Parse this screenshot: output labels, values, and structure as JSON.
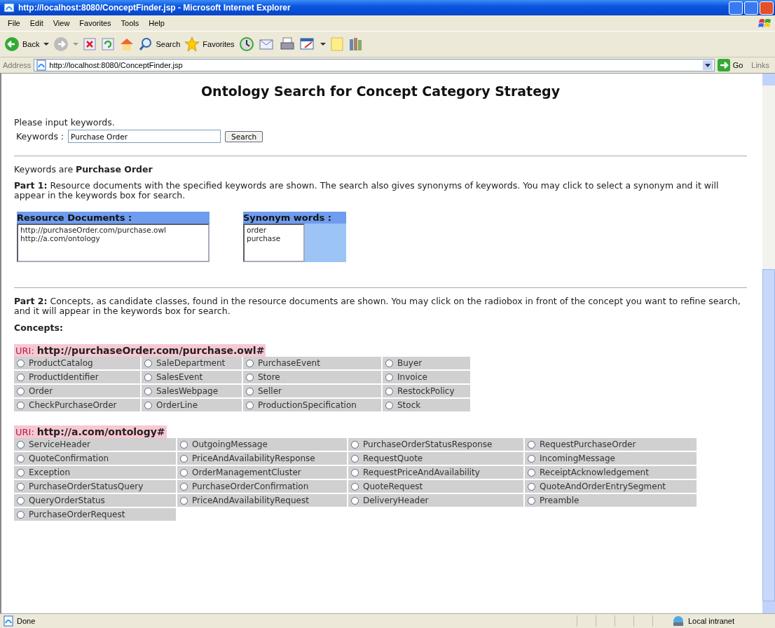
{
  "window": {
    "title": "http://localhost:8080/ConceptFinder.jsp - Microsoft Internet Explorer"
  },
  "menu_bar": [
    "File",
    "Edit",
    "View",
    "Favorites",
    "Tools",
    "Help"
  ],
  "toolbar": {
    "back": "Back",
    "search": "Search",
    "favorites": "Favorites"
  },
  "address_bar": {
    "label": "Address",
    "value": "http://localhost:8080/ConceptFinder.jsp",
    "go": "Go",
    "links": "Links"
  },
  "page": {
    "heading": "Ontology Search for Concept Category Strategy",
    "prompt": "Please input keywords.",
    "keyword_label": "Keywords :",
    "keyword_value": "Purchase Order",
    "search_button": "Search",
    "summary": "Keywords are **Purchase Order**",
    "part1": "**Part 1:** Resource documents with the specified keywords are shown. The search also gives synonyms of keywords. You may click to select a synonym and it will appear in the keywords box for search.",
    "resource_documents": {
      "header": "Resource Documents :",
      "items": [
        "http://purchaseOrder.com/purchase.owl",
        "http://a.com/ontology"
      ]
    },
    "synonyms": {
      "header": "Synonym words :",
      "items": [
        "order",
        "purchase"
      ]
    },
    "part2": "**Part 2:** Concepts, as candidate classes, found in the resource documents are shown. You may click on the radiobox in front of the concept you want to refine search, and it will appear in the keywords box for search.",
    "concepts_label": "Concepts:",
    "ontologies": [
      {
        "uri_label": "URI:",
        "uri": "http://purchaseOrder.com/purchase.owl#",
        "concepts": [
          {
            "label": "ProductCatalog",
            "selected": false
          },
          {
            "label": "SaleDepartment",
            "selected": false
          },
          {
            "label": "PurchaseEvent",
            "selected": false
          },
          {
            "label": "Buyer",
            "selected": false
          },
          {
            "label": "ProductIdentifier",
            "selected": false
          },
          {
            "label": "SalesEvent",
            "selected": false
          },
          {
            "label": "Store",
            "selected": false
          },
          {
            "label": "Invoice",
            "selected": false
          },
          {
            "label": "Order",
            "selected": false
          },
          {
            "label": "SalesWebpage",
            "selected": false
          },
          {
            "label": "Seller",
            "selected": false
          },
          {
            "label": "RestockPolicy",
            "selected": false
          },
          {
            "label": "CheckPurchaseOrder",
            "selected": false
          },
          {
            "label": "OrderLine",
            "selected": false
          },
          {
            "label": "ProductionSpecification",
            "selected": false
          },
          {
            "label": "Stock",
            "selected": false
          }
        ]
      },
      {
        "uri_label": "URI:",
        "uri": "http://a.com/ontology#",
        "concepts": [
          {
            "label": "ServiceHeader",
            "selected": false
          },
          {
            "label": "OutgoingMessage",
            "selected": false
          },
          {
            "label": "PurchaseOrderStatusResponse",
            "selected": false
          },
          {
            "label": "RequestPurchaseOrder",
            "selected": false
          },
          {
            "label": "QuoteConfirmation",
            "selected": false
          },
          {
            "label": "PriceAndAvailabilityResponse",
            "selected": false
          },
          {
            "label": "RequestQuote",
            "selected": false
          },
          {
            "label": "IncomingMessage",
            "selected": false
          },
          {
            "label": "Exception",
            "selected": false
          },
          {
            "label": "OrderManagementCluster",
            "selected": false
          },
          {
            "label": "RequestPriceAndAvailability",
            "selected": false
          },
          {
            "label": "ReceiptAcknowledgement",
            "selected": false
          },
          {
            "label": "PurchaseOrderStatusQuery",
            "selected": false
          },
          {
            "label": "PurchaseOrderConfirmation",
            "selected": false
          },
          {
            "label": "QuoteRequest",
            "selected": false
          },
          {
            "label": "QuoteAndOrderEntrySegment",
            "selected": false
          },
          {
            "label": "QueryOrderStatus",
            "selected": false
          },
          {
            "label": "PriceAndAvailabilityRequest",
            "selected": false
          },
          {
            "label": "DeliveryHeader",
            "selected": false
          },
          {
            "label": "Preamble",
            "selected": false
          },
          {
            "label": "PurchaseOrderRequest",
            "selected": false
          }
        ]
      }
    ]
  },
  "status_bar": {
    "text": "Done",
    "zone": "Local intranet"
  }
}
